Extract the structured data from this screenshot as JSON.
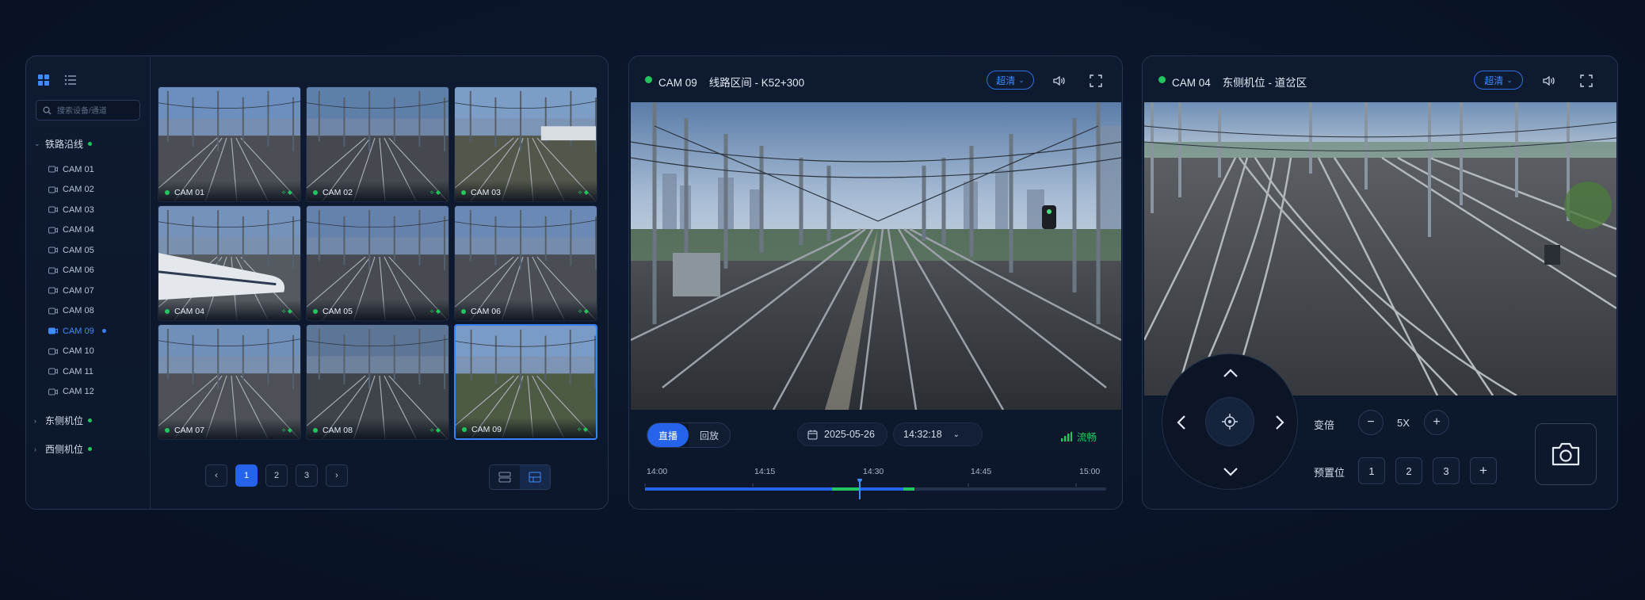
{
  "left_panel": {
    "search_placeholder": "搜索设备/通道",
    "groups": [
      {
        "label": "铁路沿线"
      },
      {
        "label": "东侧机位"
      },
      {
        "label": "西侧机位"
      }
    ],
    "cameras": [
      "CAM 01",
      "CAM 02",
      "CAM 03",
      "CAM 04",
      "CAM 05",
      "CAM 06",
      "CAM 07",
      "CAM 08",
      "CAM 09",
      "CAM 10",
      "CAM 11",
      "CAM 12"
    ],
    "active_camera": "CAM 09",
    "tiles": [
      "CAM 01",
      "CAM 02",
      "CAM 03",
      "CAM 04",
      "CAM 05",
      "CAM 06",
      "CAM 07",
      "CAM 08",
      "CAM 09"
    ],
    "pages": [
      "1",
      "2",
      "3"
    ],
    "current_page": "1",
    "prev_icon": "chevron-left-icon",
    "next_icon": "chevron-right-icon"
  },
  "main_player": {
    "title": "CAM 09    线路区间 - K52+300",
    "quality": "超清",
    "mode_live": "直播",
    "mode_playback": "回放",
    "date": "2025-05-26",
    "time": "14:32:18",
    "status": "流畅",
    "timeline_labels": [
      "14:00",
      "14:15",
      "14:30",
      "14:45",
      "15:00"
    ],
    "status_color": "#22c55e",
    "accent_color": "#2563eb"
  },
  "ptz_player": {
    "title": "CAM 04    东侧机位 - 道岔区",
    "quality": "超清",
    "zoom_label": "变倍",
    "zoom_value": "5X",
    "preset_label": "预置位",
    "presets": [
      "1",
      "2",
      "3"
    ]
  }
}
